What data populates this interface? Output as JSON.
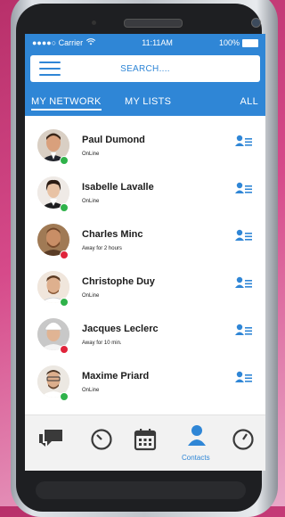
{
  "status_bar": {
    "carrier": "●●●●○ Carrier",
    "time": "11:11AM",
    "battery": "100%"
  },
  "search": {
    "placeholder": "SEARCH...."
  },
  "tabs": [
    {
      "label": "MY NETWORK",
      "active": true
    },
    {
      "label": "MY LISTS",
      "active": false
    },
    {
      "label": "ALL",
      "active": false
    }
  ],
  "contacts": [
    {
      "name": "Paul Dumond",
      "status": "OnLine",
      "presence": "online"
    },
    {
      "name": "Isabelle Lavalle",
      "status": "OnLine",
      "presence": "online"
    },
    {
      "name": "Charles Minc",
      "status": "Away for 2 hours",
      "presence": "away"
    },
    {
      "name": "Christophe Duy",
      "status": "OnLine",
      "presence": "online"
    },
    {
      "name": "Jacques Leclerc",
      "status": "Away for 10 min.",
      "presence": "away"
    },
    {
      "name": "Maxime Priard",
      "status": "OnLine",
      "presence": "online"
    }
  ],
  "bottom_nav": [
    {
      "icon": "chat-icon",
      "label": ""
    },
    {
      "icon": "history-icon",
      "label": ""
    },
    {
      "icon": "calendar-icon",
      "label": ""
    },
    {
      "icon": "contacts-icon",
      "label": "Contacts",
      "active": true
    },
    {
      "icon": "clock-icon",
      "label": ""
    }
  ],
  "colors": {
    "accent": "#2f86d6",
    "online": "#2fb24a",
    "away": "#e0243b",
    "background": "#c23a78"
  }
}
